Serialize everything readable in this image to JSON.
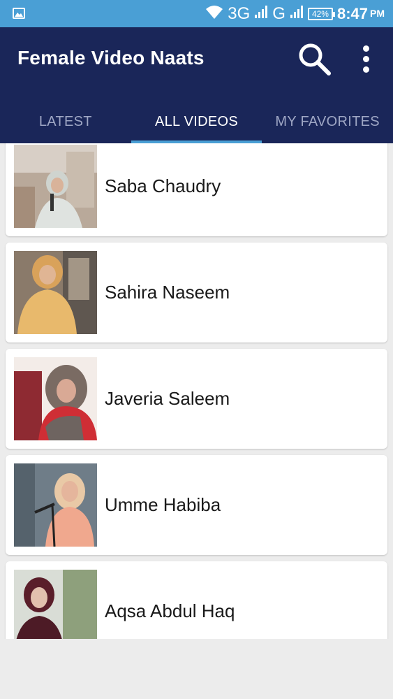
{
  "status_bar": {
    "network_3g": "3G",
    "network_g": "G",
    "battery": "42%",
    "time": "8:47",
    "ampm": "PM"
  },
  "app_bar": {
    "title": "Female Video Naats",
    "search_icon": "search-icon",
    "menu_icon": "more-vert-icon"
  },
  "tabs": [
    {
      "label": "LATEST",
      "active": false
    },
    {
      "label": "ALL VIDEOS",
      "active": true
    },
    {
      "label": "MY FAVORITES",
      "active": false
    }
  ],
  "videos": [
    {
      "name": "Saba Chaudry"
    },
    {
      "name": "Sahira Naseem"
    },
    {
      "name": "Javeria Saleem"
    },
    {
      "name": "Umme Habiba"
    },
    {
      "name": "Aqsa Abdul Haq"
    }
  ],
  "colors": {
    "status_bar": "#4a9fd5",
    "app_bar": "#1a2659",
    "tab_indicator": "#4a9fd5",
    "inactive_tab": "#9ea6c4"
  }
}
